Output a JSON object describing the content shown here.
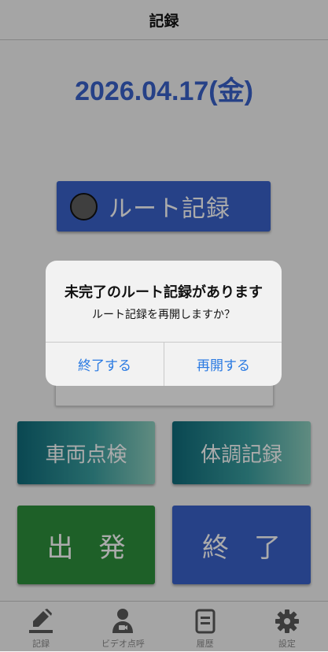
{
  "header": {
    "title": "記録"
  },
  "date": "2026.04.17(金)",
  "route_button": {
    "label": "ルート記録"
  },
  "buttons": {
    "vehicle_check": "車両点検",
    "health_record": "体調記録",
    "depart": "出発",
    "finish": "終了"
  },
  "tabs": [
    {
      "label": "記録",
      "icon": "pencil-icon"
    },
    {
      "label": "ビデオ点呼",
      "icon": "video-call-person-icon"
    },
    {
      "label": "履歴",
      "icon": "document-icon"
    },
    {
      "label": "設定",
      "icon": "gear-icon"
    }
  ],
  "dialog": {
    "title": "未完了のルート記録があります",
    "message": "ルート記録を再開しますか？",
    "cancel": "終了する",
    "confirm": "再開する"
  },
  "colors": {
    "primary_blue": "#3a62c9",
    "green": "#2e8f3c",
    "teal_start": "#0f6b7a",
    "teal_end": "#8fd0c0",
    "dialog_link": "#2a7ae2"
  }
}
